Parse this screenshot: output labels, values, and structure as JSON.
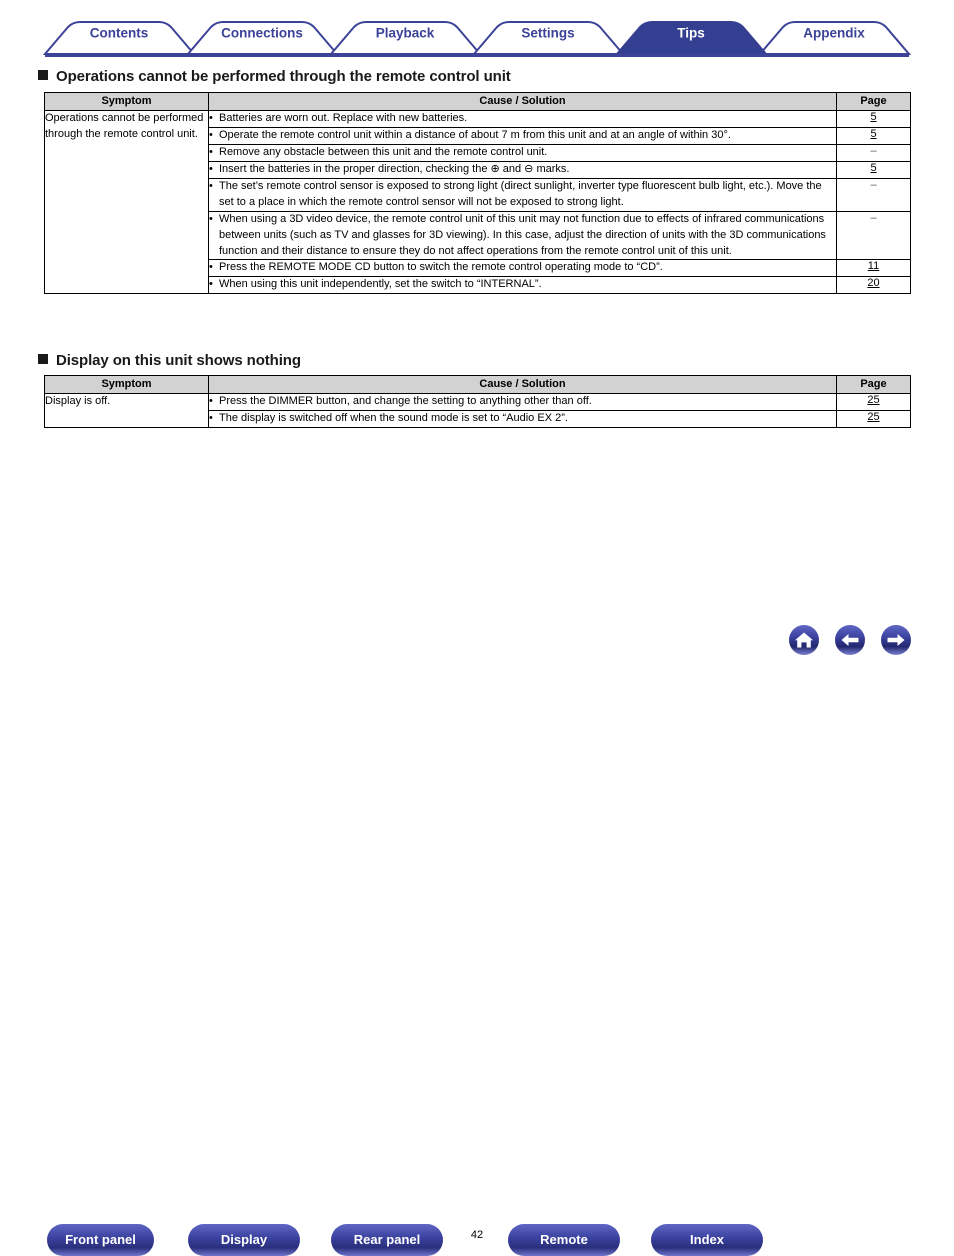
{
  "tabs": [
    {
      "label": "Contents",
      "active": false
    },
    {
      "label": "Connections",
      "active": false
    },
    {
      "label": "Playback",
      "active": false
    },
    {
      "label": "Settings",
      "active": false
    },
    {
      "label": "Tips",
      "active": true
    },
    {
      "label": "Appendix",
      "active": false
    }
  ],
  "colors": {
    "brand_blue": "#3b4298",
    "active_tab_bg": "#353f91",
    "table_header_bg": "#d2d2d2",
    "table_border": "#000000"
  },
  "sections": [
    {
      "heading": "Operations cannot be performed through the remote control unit",
      "columns": [
        "Symptom",
        "Cause / Solution",
        "Page"
      ],
      "symptom": "Operations cannot be performed through the remote control unit.",
      "rows": [
        {
          "cause": "Batteries are worn out. Replace with new batteries.",
          "page": "5"
        },
        {
          "cause": "Operate the remote control unit within a distance of about 7 m from this unit and at an angle of within 30°.",
          "page": "5"
        },
        {
          "cause": "Remove any obstacle between this unit and the remote control unit.",
          "page": "–"
        },
        {
          "cause": "Insert the batteries in the proper direction, checking the ⊕ and ⊖ marks.",
          "page": "5"
        },
        {
          "cause": "The set’s remote control sensor is exposed to strong light (direct sunlight, inverter type fluorescent bulb light, etc.). Move the set to a place in which the remote control sensor will not be exposed to strong light.",
          "page": "–"
        },
        {
          "cause": "When using a 3D video device, the remote control unit of this unit may not function due to effects of infrared communications between units (such as TV and glasses for 3D viewing). In this case, adjust the direction of units with the 3D communications function and their distance to ensure they do not affect operations from the remote control unit of this unit.",
          "page": "–"
        },
        {
          "cause": "Press the REMOTE MODE CD button to switch the remote control operating mode to “CD”.",
          "page": "11"
        },
        {
          "cause": "When using this unit independently, set the switch to “INTERNAL”.",
          "page": "20"
        }
      ]
    },
    {
      "heading": "Display on this unit shows nothing",
      "columns": [
        "Symptom",
        "Cause / Solution",
        "Page"
      ],
      "symptom": "Display is off.",
      "rows": [
        {
          "cause": "Press the DIMMER button, and change the setting to anything other than off.",
          "page": "25"
        },
        {
          "cause": "The display is switched off when the sound mode is set to “Audio EX 2”.",
          "page": "25"
        }
      ]
    }
  ],
  "footer": {
    "buttons": [
      {
        "label": "Front panel"
      },
      {
        "label": "Display"
      },
      {
        "label": "Rear panel"
      },
      {
        "label": "Remote"
      },
      {
        "label": "Index"
      }
    ],
    "page_number": "42",
    "icons": [
      {
        "name": "home-icon"
      },
      {
        "name": "arrow-left-icon"
      },
      {
        "name": "arrow-right-icon"
      }
    ]
  }
}
